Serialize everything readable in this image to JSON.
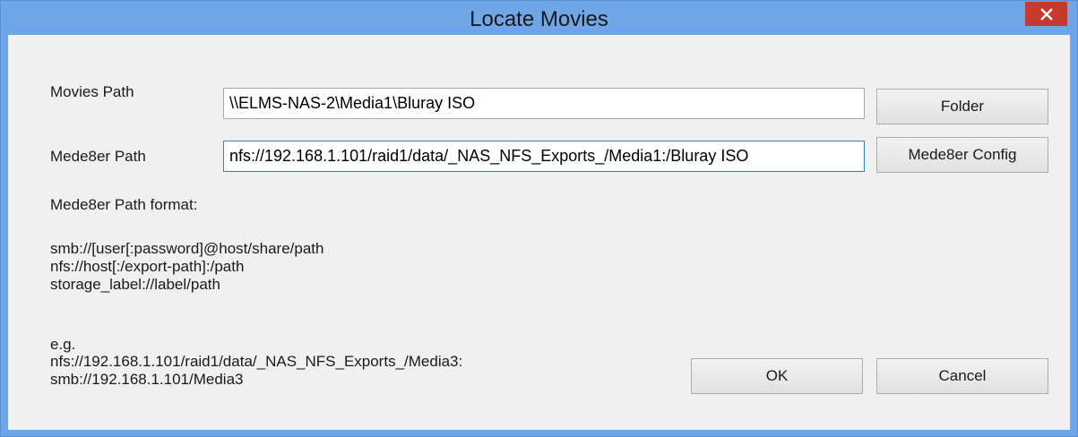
{
  "window": {
    "title": "Locate Movies"
  },
  "form": {
    "movies_path_label": "Movies Path",
    "movies_path_value": "\\\\ELMS-NAS-2\\Media1\\Bluray ISO",
    "mede8er_path_label": "Mede8er Path",
    "mede8er_path_value": "nfs://192.168.1.101/raid1/data/_NAS_NFS_Exports_/Media1:/Bluray ISO"
  },
  "buttons": {
    "folder": "Folder",
    "mede8er_config": "Mede8er Config",
    "ok": "OK",
    "cancel": "Cancel"
  },
  "help": {
    "format_heading": "Mede8er Path format:",
    "format_lines": [
      "smb://[user[:password]@host/share/path",
      "nfs://host[:/export-path]:/path",
      "storage_label://label/path"
    ],
    "example_heading": "e.g.",
    "example_lines": [
      "nfs://192.168.1.101/raid1/data/_NAS_NFS_Exports_/Media3:",
      "smb://192.168.1.101/Media3"
    ]
  },
  "colors": {
    "titlebar": "#6fa6e8",
    "close_button": "#c7392b",
    "client_bg": "#f0f0f0",
    "focus_border": "#3c7fb1"
  },
  "icons": {
    "close": "close-icon"
  }
}
